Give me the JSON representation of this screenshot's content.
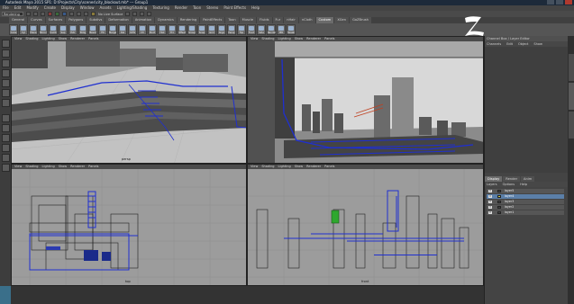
{
  "window": {
    "title": "Autodesk Maya 2015 SP1: D:\\Projects\\City\\scenes\\city_blockout.mb* --- Group1"
  },
  "menubar": {
    "items": [
      "File",
      "Edit",
      "Modify",
      "Create",
      "Display",
      "Window",
      "Assets",
      "Lighting/Shading",
      "Texturing",
      "Render",
      "Toon",
      "Stereo",
      "Paint Effects",
      "Help"
    ]
  },
  "statusline": {
    "menu_set": "Rendering",
    "no_live_surface": "No Live Surface"
  },
  "shelf": {
    "tabs": [
      "General",
      "Curves",
      "Surfaces",
      "Polygons",
      "Subdivs",
      "Deformation",
      "Animation",
      "Dynamics",
      "Rendering",
      "PaintEffects",
      "Toon",
      "Muscle",
      "Fluids",
      "Fur",
      "nHair",
      "nCloth",
      "Custom",
      "XGen",
      "GoZBrush"
    ],
    "active_tab": "Custom",
    "buttons": [
      "Cube",
      "Cyl",
      "Plane",
      "Mirror",
      "Comb",
      "Sep",
      "Extr",
      "Brdg",
      "Bevel",
      "Fill",
      "Merge",
      "Del",
      "UVW",
      "Ctr",
      "Pivot",
      "Hist",
      "Frz",
      "Offset",
      "Group",
      "Snap",
      "Grid",
      "Align",
      "Persp",
      "Top",
      "Front",
      "Side",
      "Render",
      "IPR",
      "Tweak"
    ]
  },
  "viewports": {
    "menu": [
      "View",
      "Shading",
      "Lighting",
      "Show",
      "Renderer",
      "Panels"
    ],
    "persp_label": "persp",
    "top_label": "top",
    "front_label": "front"
  },
  "channel_box": {
    "title": "Channel Box / Layer Editor",
    "menu": [
      "Channels",
      "Edit",
      "Object",
      "Show"
    ],
    "layer_tabs": [
      "Display",
      "Render",
      "Anim"
    ],
    "layer_menu": [
      "Layers",
      "Options",
      "Help"
    ],
    "layers": [
      {
        "name": "layer5",
        "visible": "V",
        "color": "#444444",
        "selected": false
      },
      {
        "name": "layer4",
        "visible": "V",
        "color": "#c8c84a",
        "selected": true
      },
      {
        "name": "layer3",
        "visible": "V",
        "color": "#444444",
        "selected": false
      },
      {
        "name": "layer2",
        "visible": "V",
        "color": "#444444",
        "selected": false
      },
      {
        "name": "layer1",
        "visible": "V",
        "color": "#444444",
        "selected": false
      }
    ]
  },
  "side_tabs": [
    "Attribute Editor",
    "Channel Box / Layer Editor",
    "Modeling Toolkit"
  ],
  "colors": {
    "wire_blue": "#1f2fd0",
    "selected_green": "#2ea82e",
    "maya_grey": "#a3a3a3"
  }
}
